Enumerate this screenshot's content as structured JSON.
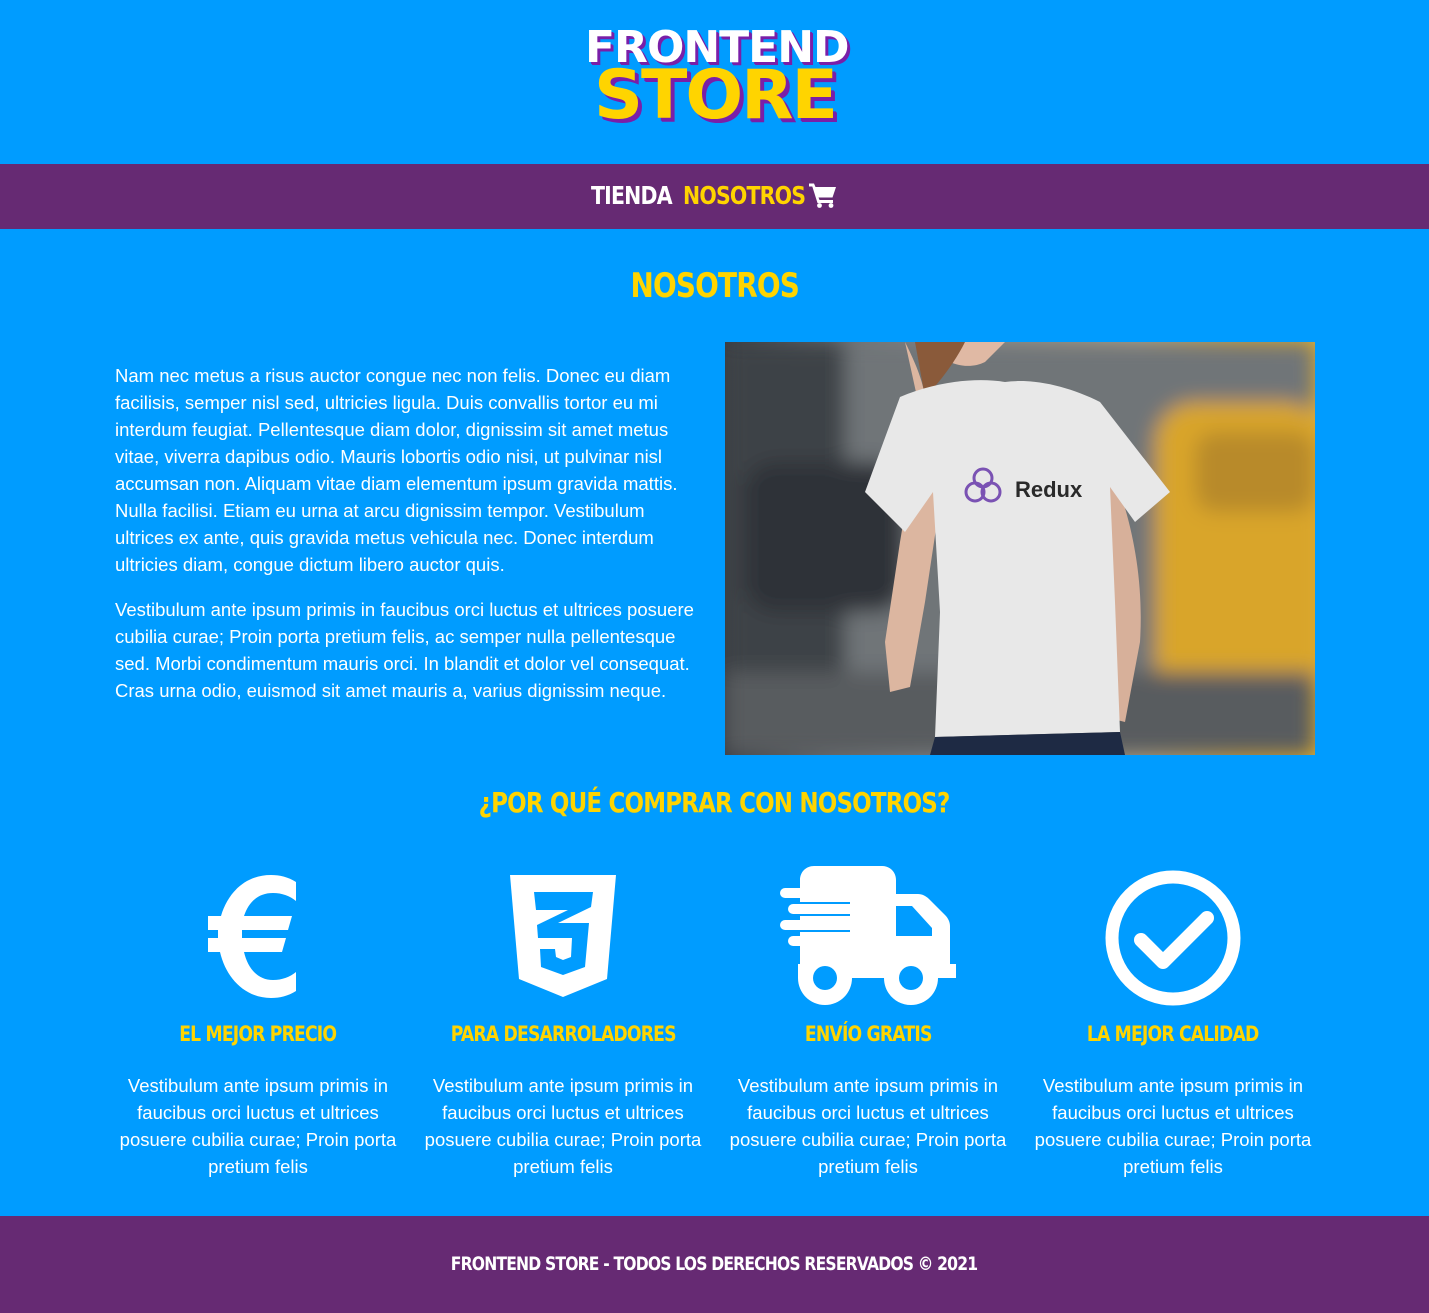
{
  "brand": {
    "line1": "FRONTEND",
    "line2": "STORE",
    "colors": {
      "accent": "#ffd400",
      "shadow": "#7a1fa8",
      "background": "#009cff",
      "nav": "#662a73"
    }
  },
  "nav": {
    "items": [
      {
        "label": "TIENDA"
      },
      {
        "label": "NOSOTROS"
      }
    ],
    "cart_icon": "shopping-cart-icon"
  },
  "page": {
    "title": "NOSOTROS",
    "paragraphs": [
      "Nam nec metus a risus auctor congue nec non felis. Donec eu diam facilisis, semper nisl sed, ultricies ligula. Duis convallis tortor eu mi interdum feugiat. Pellentesque diam dolor, dignissim sit amet metus vitae, viverra dapibus odio. Mauris lobortis odio nisi, ut pulvinar nisl accumsan non. Aliquam vitae diam elementum ipsum gravida mattis. Nulla facilisi. Etiam eu urna at arcu dignissim tempor. Vestibulum ultrices ex ante, quis gravida metus vehicula nec. Donec interdum ultricies diam, congue dictum libero auctor quis.",
      "Vestibulum ante ipsum primis in faucibus orci luctus et ultrices posuere cubilia curae; Proin porta pretium felis, ac semper nulla pellentesque sed. Morbi condimentum mauris orci. In blandit et dolor vel consequat. Cras urna odio, euismod sit amet mauris a, varius dignissim neque."
    ],
    "photo": {
      "shirt_text": "Redux"
    }
  },
  "why": {
    "title": "¿POR QUÉ COMPRAR CON NOSOTROS?",
    "features": [
      {
        "icon": "euro-icon",
        "title": "EL MEJOR PRECIO",
        "text": "Vestibulum ante ipsum primis in faucibus orci luctus et ultrices posuere cubilia curae; Proin porta pretium felis"
      },
      {
        "icon": "css3-icon",
        "title": "PARA DESARROLADORES",
        "text": "Vestibulum ante ipsum primis in faucibus orci luctus et ultrices posuere cubilia curae; Proin porta pretium felis"
      },
      {
        "icon": "shipping-truck-icon",
        "title": "ENVÍO GRATIS",
        "text": "Vestibulum ante ipsum primis in faucibus orci luctus et ultrices posuere cubilia curae; Proin porta pretium felis"
      },
      {
        "icon": "check-circle-icon",
        "title": "LA MEJOR CALIDAD",
        "text": "Vestibulum ante ipsum primis in faucibus orci luctus et ultrices posuere cubilia curae; Proin porta pretium felis"
      }
    ]
  },
  "footer": {
    "text": "FRONTEND STORE - TODOS LOS DERECHOS RESERVADOS © 2021"
  }
}
